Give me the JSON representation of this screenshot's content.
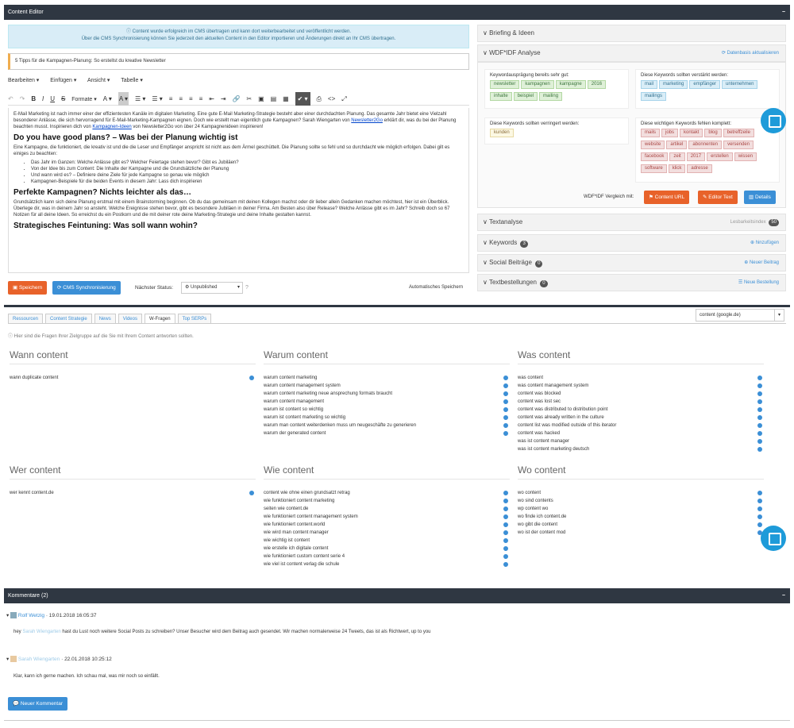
{
  "editor": {
    "panel_title": "Content Editor",
    "minimize": "−",
    "notice_line1": "Content wurde erfolgreich im CMS übertragen und kann dort weiterbearbeitet und veröffentlicht werden.",
    "notice_line2": "Über die CMS Synchronisierung können Sie jederzeit den aktuellen Content in den Editor importieren und Änderungen direkt an Ihr CMS übertragen.",
    "title_value": "5 Tipps für die Kampagnen-Planung: So erstellst du kreative Newsletter",
    "menu": [
      "Bearbeiten ▾",
      "Einfügen ▾",
      "Ansicht ▾",
      "Tabelle ▾"
    ],
    "toolbar": [
      "↶",
      "↷",
      "B",
      "I",
      "U",
      "S",
      "Formate ▾",
      "A ▾",
      "A ▾",
      "☰ ▾",
      "☰ ▾",
      "≡",
      "≡",
      "≡",
      "≡",
      "⇤",
      "⇥",
      "🔗",
      "✂",
      "▣",
      "▤",
      "▦",
      "✔ ▾",
      "⎙",
      "<>",
      "⤢"
    ],
    "body": {
      "p1a": "E-Mail Marketing ist nach immer einer der effizientesten Kanäle im digitalen Marketing. Eine gute E-Mail Marketing-Strategie besteht aber einer durchdachten Planung. Das gesamte Jahr bietet eine Vielzahl besonderer Anlässe, die sich hervorragend für E-Mail-Marketing-Kampagnen eignen. Doch wie erstellt man eigentlich gute Kampagnen? Sarah Wiengarten von ",
      "p1link1": "Newsletter2Go",
      "p1b": " erklärt dir, was du bei der Planung beachten musst. Inspirieren dich von ",
      "p1link2": "Kampagnen-Ideen",
      "p1c": " von Newsletter2Go von über 24 Kampagnenideen inspirieren!",
      "h1": "Do you have good plans? – Was bei der Planung wichtig ist",
      "p2": "Eine Kampagne, die funktioniert, die kreativ ist und die die Leser und Empfänger anspricht ist nicht aus dem Ärmel geschüttelt. Die Planung sollte so fehl und so durchdacht wie möglich erfolgen. Dabei gilt es einiges zu beachten:",
      "li1": "Das Jahr im Ganzen: Welche Anlässe gibt es? Welcher Feiertage stehen bevor? Gibt es Jubiläen?",
      "li2": "Von der Idee bis zum Content: Die Inhalte der Kampagne und die Grundsätzliche der Planung",
      "li3": "Und wann wird es? – Definiere deine Ziele für jede Kampagne so genau wie möglich",
      "li4": "Kampagnen-Beispiele für die beiden Events in diesem Jahr: Lass dich inspirieren",
      "h2": "Perfekte Kampagnen? Nichts leichter als das…",
      "p3": "Grundsätzlich kann sich deine Planung erstmal mit einem Brainstorming beginnen. Ob du das gemeinsam mit deinen Kollegen machst oder dir lieber allein Gedanken machen möchtest, hier ist ein Überblick. Überlege dir, was in deinem Jahr so ansteht. Welche Ereignisse stehen bevor, gibt es besondere Jubiläen in deiner Firma. Am Besten also über Release? Welche Anlässe gibt es im Jahr? Schreib doch so 67 Notizen für all deine Ideen. So erreichst du ein Postkorn und die mit deiner rote deine Marketing-Strategie und deine Inhalte gestalten kannst.",
      "h3": "Strategisches Feintuning: Was soll wann wohin?"
    },
    "save_label": "Speichern",
    "sync_label": "CMS Synchronisierung",
    "next_status_label": "Nächster Status:",
    "status_value": "Unpublished",
    "autosave_label": "Automatisches Speichern"
  },
  "right": {
    "briefing": "Briefing & Ideen",
    "wdf": "WDF*IDF Analyse",
    "data_update": "Datenbasis aktualisieren",
    "good_head": "Keywordausprägung bereits sehr gut:",
    "good_tags": [
      "newsletter",
      "kampagnen",
      "kampagne",
      "2016",
      "inhalte",
      "beispiel",
      "mailing"
    ],
    "more_head": "Diese Keywords sollten verstärkt werden:",
    "more_tags": [
      "mail",
      "marketing",
      "empfänger",
      "unternehmen",
      "mailings"
    ],
    "less_head": "Diese Keywords sollten verringert werden:",
    "less_tags": [
      "kunden"
    ],
    "missing_head": "Diese wichtigen Keywords fehlen komplett:",
    "missing_tags": [
      "mails",
      "jobs",
      "kontakt",
      "blog",
      "betreffzeile",
      "website",
      "artikel",
      "abonnenten",
      "versenden",
      "facebook",
      "zeit",
      "2017",
      "erstellen",
      "wissen",
      "software",
      "klick",
      "adresse"
    ],
    "compare_label": "WDF*IDF Vergleich mit:",
    "btn_url": "Content URL",
    "btn_text": "Editor Text",
    "btn_details": "Details",
    "textanalyse": "Textanalyse",
    "lesbarkeit": "Lesbarkeitsindex",
    "lesbarkeit_value": "50",
    "keywords": "Keywords",
    "keywords_count": "3",
    "keywords_action": "hinzufügen",
    "social": "Social Beiträge",
    "social_count": "0",
    "social_action": "Neuer Beitrag",
    "textbest": "Textbestellungen",
    "textbest_count": "0",
    "textbest_action": "Neue Bestellung"
  },
  "research": {
    "tabs": [
      "Ressourcen",
      "Content Strategie",
      "News",
      "Videos",
      "W-Fragen",
      "Top SERPs"
    ],
    "active_tab": "W-Fragen",
    "lang_select": "content (google.de)",
    "hint": "Hier sind die Fragen Ihrer Zielgruppe auf die Sie mit Ihrem Content antworten sollten.",
    "groups": [
      {
        "title": "Wann content",
        "items": [
          "wann duplicate content"
        ]
      },
      {
        "title": "Warum content",
        "items": [
          "warum content marketing",
          "warum content management system",
          "warum content marketing neue ansprechung formats braucht",
          "warum content management",
          "warum ist content so wichtig",
          "warum ist content marketing so wichtig",
          "warum man content weiterdenken muss um neugeschäfte zu generieren",
          "warum der generated content"
        ]
      },
      {
        "title": "Was content",
        "items": [
          "was content",
          "was content management system",
          "content was blocked",
          "content was lost sec",
          "content was distributed to distribution point",
          "content was already written in the culture",
          "content list was modified outside of this iterator",
          "content was hacked",
          "was ist content manager",
          "was ist content marketing deutsch"
        ]
      },
      {
        "title": "Wer content",
        "items": [
          "wer kennt content.de"
        ]
      },
      {
        "title": "Wie content",
        "items": [
          "content wie ohne einen grundsatzt retrag",
          "wie funktioniert content marketing",
          "seiten wie content.de",
          "wie funktioniert content management system",
          "wie funktioniert content.world",
          "wie wird man content manager",
          "wie wichtig ist content",
          "wie erstelle ich digitale content",
          "wie funktioniert custom content serie 4",
          "wie viel ist content verlag die schule"
        ]
      },
      {
        "title": "Wo content",
        "items": [
          "wo content",
          "wo sind contents",
          "wp content wo",
          "wo finde ich content.de",
          "wo gibt die content",
          "wo ist der content mod"
        ]
      }
    ]
  },
  "comments": {
    "panel_title": "Kommentare (2)",
    "c1_user": "Rolf Wetzig",
    "c1_date": "· 19.01.2018 16:05:37",
    "c1_text_a": "hey ",
    "c1_mention": "Sarah Wiengarten",
    "c1_text_b": " hast du Lust noch weitere Social Posts zu schreiben? Unser Besucher wird dem Beitrag auch gesendet. Wir machen normalerweise 24 Tweets, das ist als Richtwert, up to you",
    "c2_user": "Sarah Wiengarten",
    "c2_date": "· 22.01.2018 10:25:12",
    "c2_text": "Klar, kann ich gerne machen. Ich schau mal, was mir noch so einfällt.",
    "new_comment": "Neuer Kommentar"
  }
}
